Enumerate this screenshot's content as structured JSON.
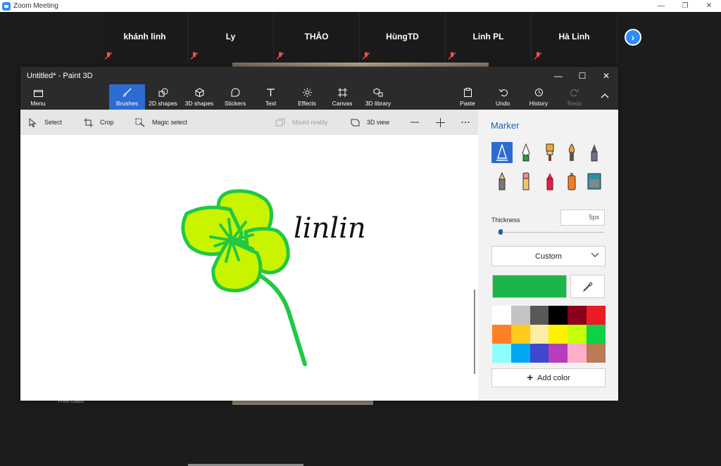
{
  "zoom": {
    "title": "Zoom Meeting",
    "participants": [
      "khánh linh",
      "Ly",
      "THẢO",
      "HùngTD",
      "Linh PL",
      "Hà Linh"
    ],
    "bottom_label": "Free class"
  },
  "paint": {
    "title": "Untitled* - Paint 3D",
    "ribbon": {
      "menu": "Menu",
      "brushes": "Brushes",
      "shapes2d": "2D shapes",
      "shapes3d": "3D shapes",
      "stickers": "Stickers",
      "text": "Text",
      "effects": "Effects",
      "canvas": "Canvas",
      "library3d": "3D library",
      "paste": "Paste",
      "undo": "Undo",
      "history": "History",
      "redo": "Redo"
    },
    "toolbar": {
      "select": "Select",
      "crop": "Crop",
      "magic_select": "Magic select",
      "mixed_reality": "Mixed reality",
      "view3d": "3D view"
    },
    "canvas": {
      "handwriting": "linlin"
    },
    "panel": {
      "title": "Marker",
      "brushes": [
        "marker",
        "calligraphy-pen",
        "oil-brush",
        "watercolor",
        "pixel-pen",
        "pencil",
        "eraser",
        "crayon",
        "spray-can",
        "fill"
      ],
      "selected_brush": "marker",
      "thickness_label": "Thickness",
      "thickness_value": "5px",
      "thickness_level": 0.03,
      "opacity_mode": "Custom",
      "current_color": "#1bb54a",
      "add_color": "Add color",
      "palette": [
        "#ffffff",
        "#c3c3c3",
        "#585858",
        "#000000",
        "#88001b",
        "#ec1c24",
        "#ff7f27",
        "#ffca18",
        "#fdeca6",
        "#fff200",
        "#c4ff0e",
        "#0ed145",
        "#8cfffb",
        "#00a8f3",
        "#3f48cc",
        "#b83dba",
        "#ffaec8",
        "#b97a56"
      ]
    }
  }
}
